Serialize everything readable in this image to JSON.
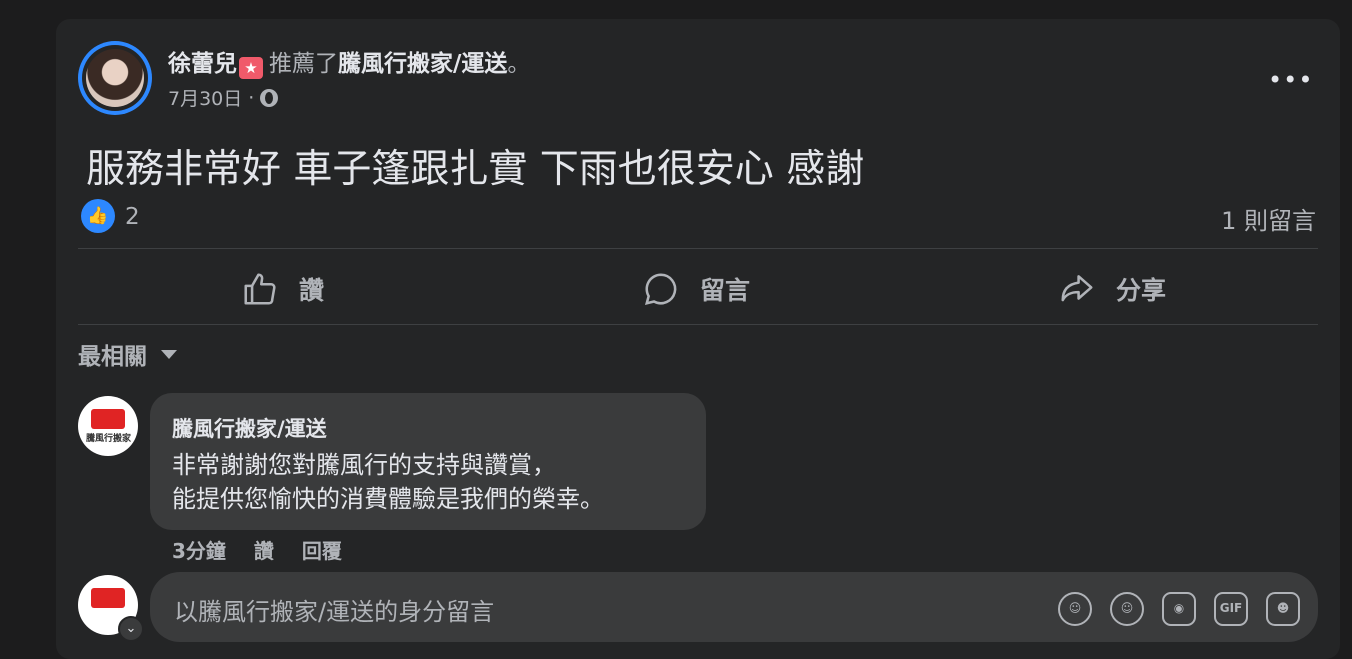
{
  "post": {
    "author": "徐蕾兒",
    "action_text": "推薦了",
    "page_name": "騰風行搬家/運送",
    "period": "。",
    "date": "7月30日",
    "dot": "·",
    "more": "•••",
    "body": "服務非常好 車子篷跟扎實 下雨也很安心 感謝",
    "like_count": "2",
    "comment_count": "1 則留言"
  },
  "actions": {
    "like": "讚",
    "comment": "留言",
    "share": "分享"
  },
  "comments": {
    "sort_label": "最相關",
    "reply": {
      "author": "騰風行搬家/運送",
      "line1": "非常謝謝您對騰風行的支持與讚賞，",
      "line2": "能提供您愉快的消費體驗是我們的榮幸。",
      "time": "3分鐘",
      "like": "讚",
      "reply": "回覆"
    },
    "composer_placeholder": "以騰風行搬家/運送的身分留言",
    "composer_icons": {
      "avatar_sticker": "avatar-sticker-icon",
      "emoji": "emoji-icon",
      "camera": "camera-icon",
      "gif": "GIF",
      "sticker": "sticker-icon"
    }
  },
  "colors": {
    "accent": "#2d88ff",
    "card": "#242526",
    "bubble": "#3a3b3c",
    "muted": "#b0b3b8"
  }
}
